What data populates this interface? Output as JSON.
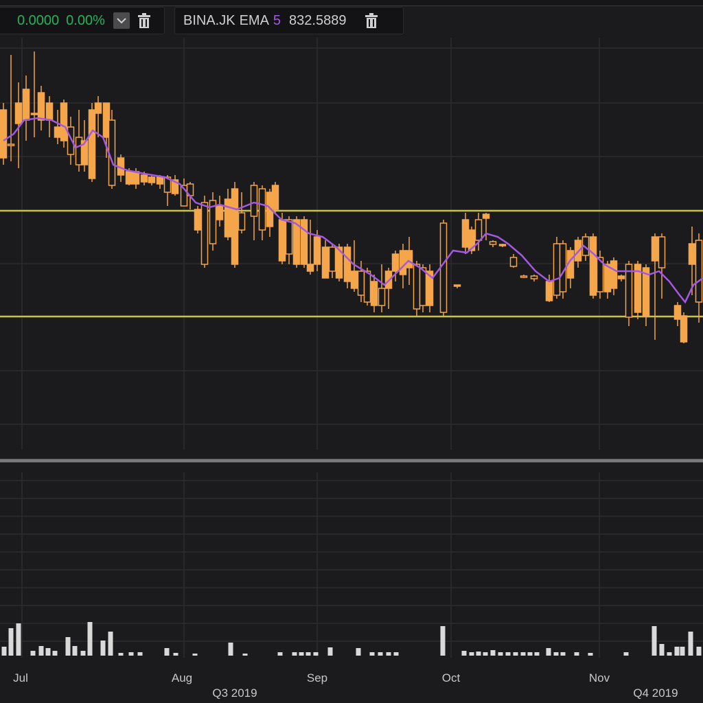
{
  "legend": {
    "change_value": "0.0000",
    "change_pct": "0.00%",
    "symbol": "BINA.JK",
    "indicator": "EMA",
    "period": "5",
    "value": "832.5889"
  },
  "icons": {
    "dropdown": "chevron-down-icon",
    "delete": "trash-icon"
  },
  "colors": {
    "background": "#1b1a1c",
    "candle": "#f5a54a",
    "ema": "#a259e3",
    "support_resistance": "#c8c24a",
    "volume": "#d9d9d9",
    "positive": "#27b35a",
    "grid": "#2d2c30"
  },
  "chart_data": {
    "type": "candlestick",
    "x_ticks": [
      "Jul",
      "Aug",
      "Sep",
      "Oct",
      "Nov"
    ],
    "quarter_labels": [
      "Q3 2019",
      "Q4 2019"
    ],
    "horizontal_levels": [
      "upper",
      "lower"
    ],
    "grid": true,
    "series": [
      {
        "name": "EMA 5"
      },
      {
        "name": "Volume"
      }
    ]
  }
}
